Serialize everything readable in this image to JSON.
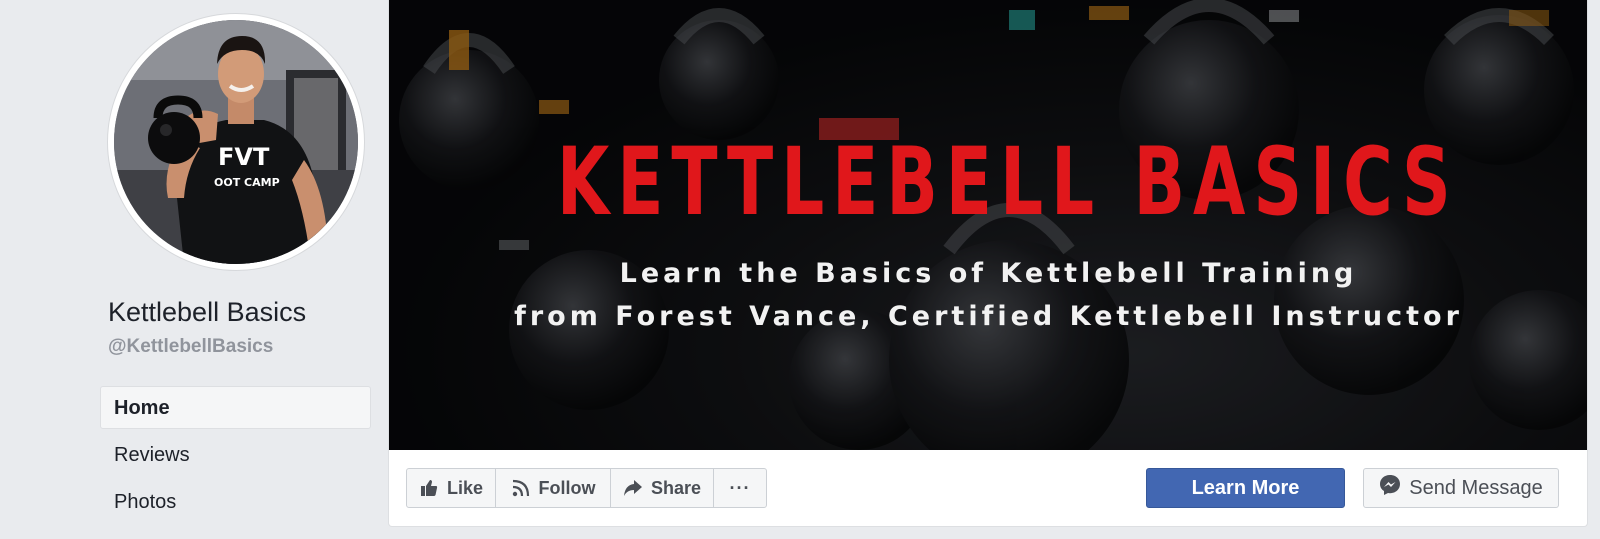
{
  "profile": {
    "name": "Kettlebell Basics",
    "handle": "@KettlebellBasics",
    "avatar_shirt_line1": "FVT",
    "avatar_shirt_line2": "OOT CAMP"
  },
  "nav": {
    "items": [
      {
        "label": "Home",
        "active": true
      },
      {
        "label": "Reviews",
        "active": false
      },
      {
        "label": "Photos",
        "active": false
      }
    ]
  },
  "cover": {
    "title": "KETTLEBELL BASICS",
    "subtitle_line1": "Learn the Basics of Kettlebell Training",
    "subtitle_line2": "from Forest Vance, Certified Kettlebell Instructor",
    "title_color": "#e0171b"
  },
  "actions": {
    "like_label": "Like",
    "follow_label": "Follow",
    "share_label": "Share",
    "more_label": "···",
    "learn_more_label": "Learn More",
    "send_message_label": "Send Message"
  },
  "colors": {
    "page_bg": "#e9ebee",
    "primary_button": "#4267b2",
    "secondary_text": "#90949c"
  }
}
